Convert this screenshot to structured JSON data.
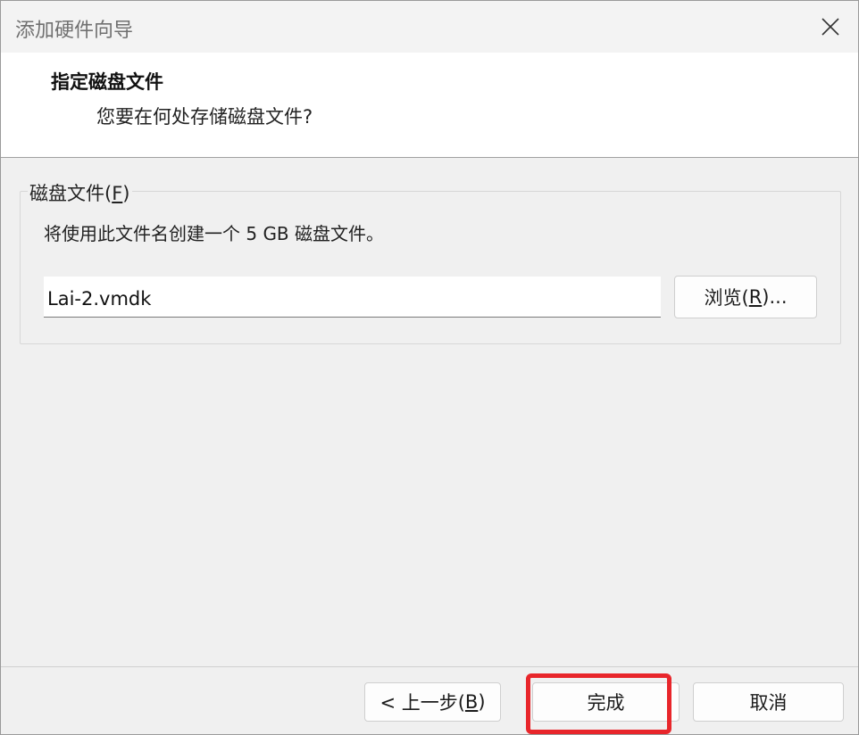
{
  "window": {
    "title": "添加硬件向导"
  },
  "header": {
    "title": "指定磁盘文件",
    "subtitle": "您要在何处存储磁盘文件?"
  },
  "disk_file_group": {
    "legend_prefix": "磁盘文件(",
    "legend_accel": "F",
    "legend_suffix": ")",
    "description": "将使用此文件名创建一个 5 GB 磁盘文件。",
    "file_value": "Lai-2.vmdk",
    "browse_prefix": "浏览(",
    "browse_accel": "R",
    "browse_suffix": ")..."
  },
  "footer": {
    "back_prefix": "< 上一步(",
    "back_accel": "B",
    "back_suffix": ")",
    "finish_label": "完成",
    "cancel_label": "取消"
  },
  "colors": {
    "highlight": "#e8262b",
    "background": "#f0f0f0",
    "header_background": "#ffffff"
  },
  "icons": {
    "close": "close-icon"
  }
}
